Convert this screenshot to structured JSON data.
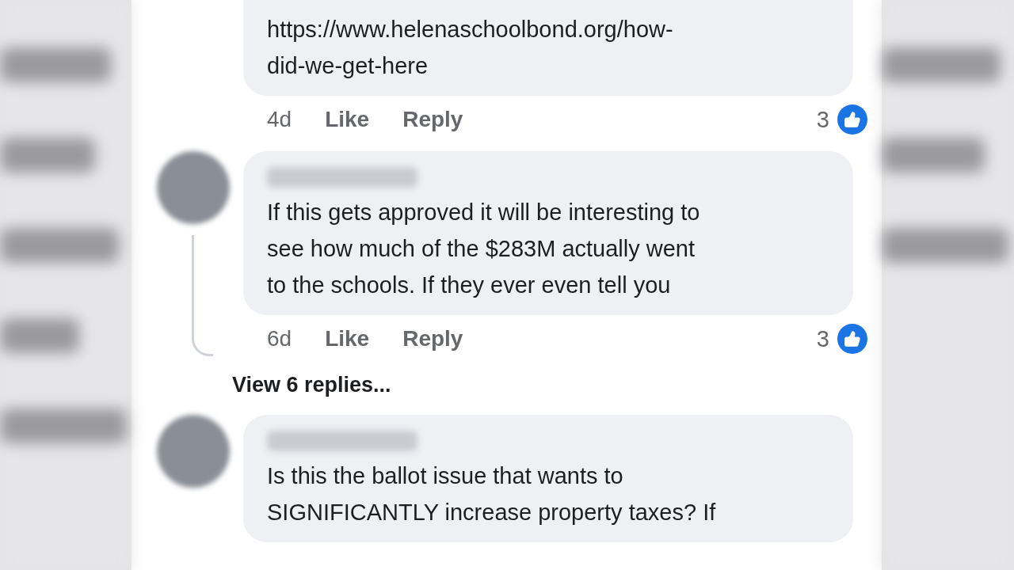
{
  "comments": [
    {
      "kind": "continued",
      "text_lines": [
        "https://www.helenaschoolbond.org/how-",
        "did-we-get-here"
      ],
      "time": "4d",
      "actions": [
        "Like",
        "Reply"
      ],
      "reactions": "3"
    },
    {
      "kind": "full",
      "text_lines": [
        "If this gets approved it will be interesting to",
        "see how much of the $283M actually went",
        "to the schools. If they ever even tell you"
      ],
      "time": "6d",
      "actions": [
        "Like",
        "Reply"
      ],
      "reactions": "3",
      "view_replies": "View 6 replies..."
    },
    {
      "kind": "full",
      "text_lines": [
        "Is this the ballot issue that wants to",
        "SIGNIFICANTLY increase property taxes? If"
      ]
    }
  ]
}
